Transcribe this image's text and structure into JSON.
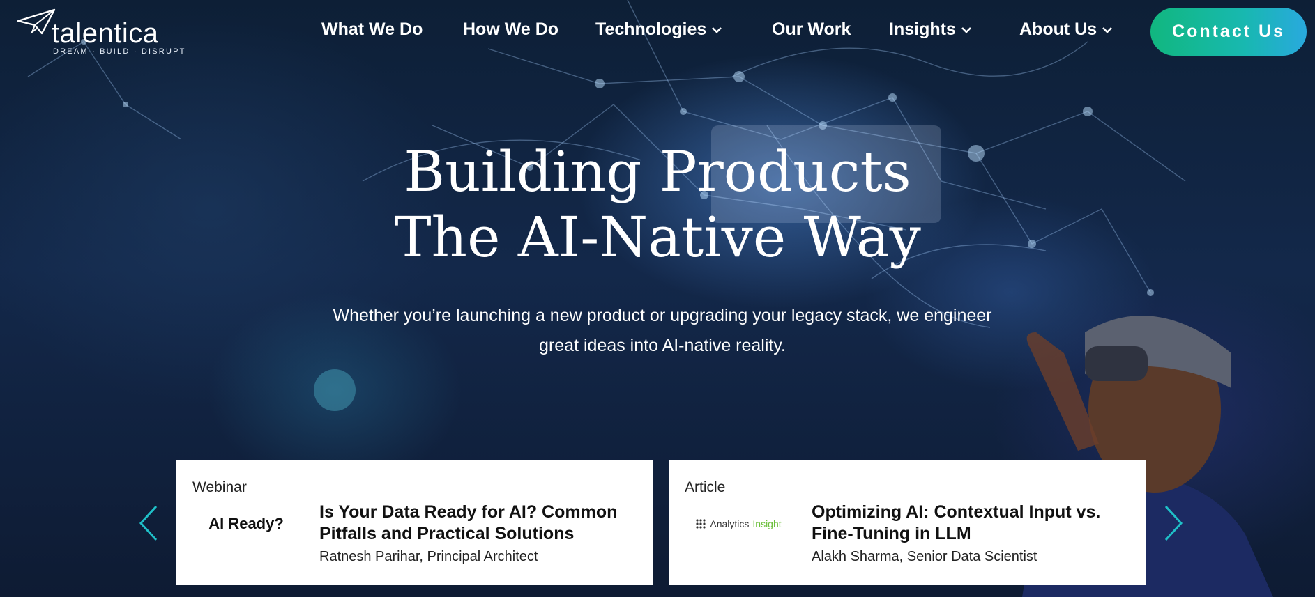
{
  "brand": {
    "name": "talentica",
    "tagline": "DREAM · BUILD · DISRUPT"
  },
  "nav": {
    "items": [
      {
        "label": "What We Do",
        "dropdown": false
      },
      {
        "label": "How We Do",
        "dropdown": false
      },
      {
        "label": "Technologies",
        "dropdown": true
      },
      {
        "label": "Our Work",
        "dropdown": false
      },
      {
        "label": "Insights",
        "dropdown": true
      },
      {
        "label": "About Us",
        "dropdown": true
      }
    ],
    "contact_label": "Contact Us"
  },
  "hero": {
    "headline_line1": "Building Products",
    "headline_line2": "The AI-Native Way",
    "subtext": "Whether you’re launching a new product or upgrading your legacy stack, we engineer great ideas into AI-native reality."
  },
  "cards": [
    {
      "type": "Webinar",
      "thumb_text": "AI Ready?",
      "title": "Is Your Data Ready for AI? Common Pitfalls and Practical Solutions",
      "author": "Ratnesh Parihar, Principal Architect"
    },
    {
      "type": "Article",
      "thumb_text_1": "Analytics",
      "thumb_text_2": "Insight",
      "title": "Optimizing AI: Contextual Input vs. Fine-Tuning in LLM",
      "author": "Alakh Sharma, Senior Data Scientist"
    }
  ],
  "icons": {
    "logo": "paper-plane-icon",
    "dropdown": "chevron-down-icon",
    "prev": "chevron-left-icon",
    "next": "chevron-right-icon"
  },
  "colors": {
    "accent_start": "#11b77f",
    "accent_end": "#29a9de",
    "arrow": "#1fc0c8",
    "analytics_green": "#6cbf3b"
  }
}
